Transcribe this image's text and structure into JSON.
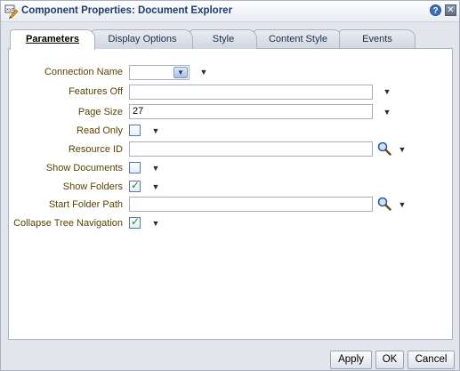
{
  "window": {
    "title": "Component Properties: Document Explorer",
    "help_glyph": "?",
    "close_glyph": "✕"
  },
  "tabs": [
    {
      "label": "Parameters",
      "active": true
    },
    {
      "label": "Display Options",
      "active": false
    },
    {
      "label": "Style",
      "active": false
    },
    {
      "label": "Content Style",
      "active": false
    },
    {
      "label": "Events",
      "active": false
    }
  ],
  "form": {
    "connection_name": {
      "label": "Connection Name",
      "value": ""
    },
    "features_off": {
      "label": "Features Off",
      "value": ""
    },
    "page_size": {
      "label": "Page Size",
      "value": "27"
    },
    "read_only": {
      "label": "Read Only",
      "checked": false
    },
    "resource_id": {
      "label": "Resource ID",
      "value": ""
    },
    "show_documents": {
      "label": "Show Documents",
      "checked": false
    },
    "show_folders": {
      "label": "Show Folders",
      "checked": true
    },
    "start_folder_path": {
      "label": "Start Folder Path",
      "value": ""
    },
    "collapse_tree_navigation": {
      "label": "Collapse Tree Navigation",
      "checked": true
    }
  },
  "footer": {
    "apply_label": "Apply",
    "ok_label": "OK",
    "cancel_label": "Cancel"
  },
  "glyphs": {
    "chevron": "▼",
    "check": "✓"
  },
  "colors": {
    "label_text": "#5a4204",
    "title_text": "#1f3d6e",
    "panel_bg": "#ffffff"
  }
}
